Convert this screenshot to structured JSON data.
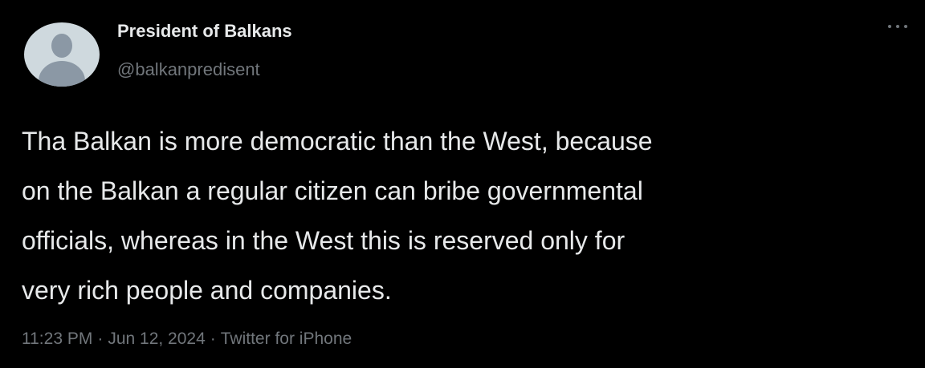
{
  "author": {
    "display_name": "President of Balkans",
    "handle": "@balkanpredisent"
  },
  "tweet": {
    "lines": [
      "Tha Balkan is more democratic than the West, because",
      "on the Balkan a regular citizen can bribe governmental",
      "officials, whereas in the West this is reserved only for",
      "very rich people and companies."
    ]
  },
  "meta": {
    "time": "11:23 PM",
    "separator": "·",
    "date": "Jun 12, 2024",
    "source": "Twitter for iPhone"
  },
  "icons": {
    "avatar": "default-avatar-icon",
    "more": "more-options-icon"
  },
  "colors": {
    "background": "#000000",
    "text_primary": "#e7e9ea",
    "text_secondary": "#71767b",
    "avatar_bg": "#cfd9de",
    "avatar_fg": "#8b98a5"
  }
}
